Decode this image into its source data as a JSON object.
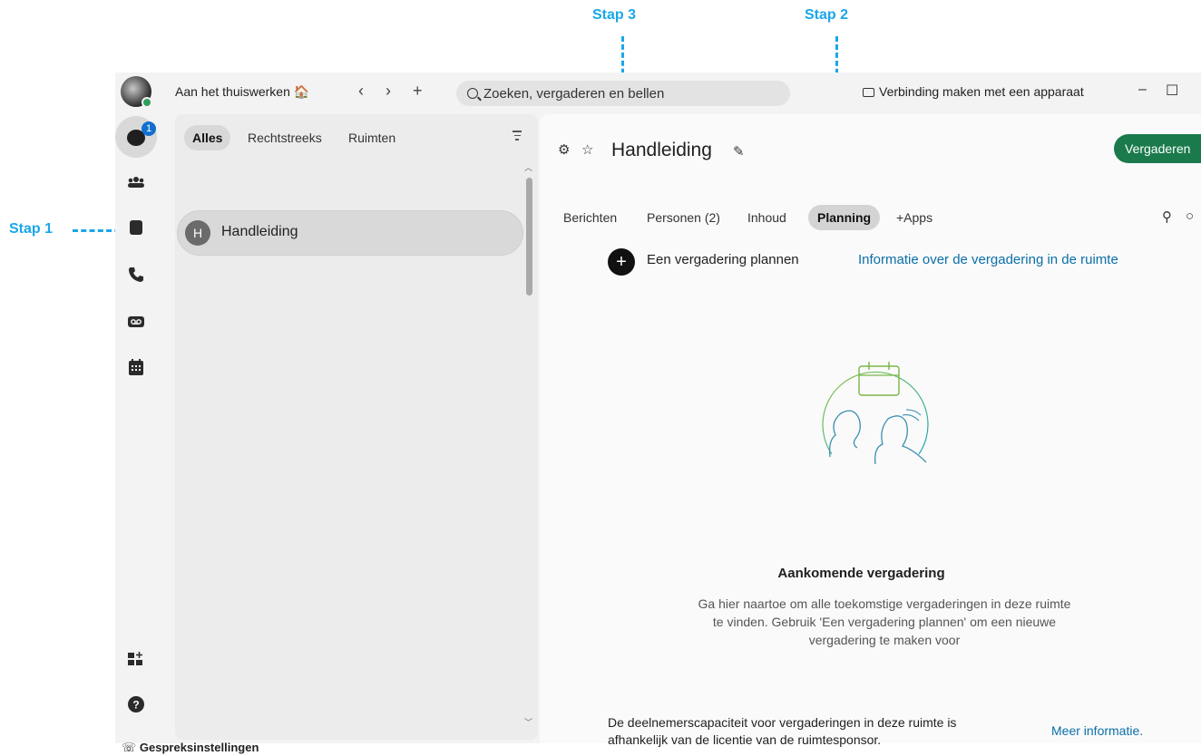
{
  "annotations": {
    "step1": "Stap 1",
    "step2": "Stap 2",
    "step3": "Stap 3",
    "color": "#1aa7e8"
  },
  "titlebar": {
    "status": "Aan het thuiswerken 🏠",
    "back_icon": "chevron-left-icon",
    "forward_icon": "chevron-right-icon",
    "add_icon": "plus-icon",
    "search_placeholder": "Zoeken, vergaderen en bellen",
    "connect_device": "Verbinding maken met een apparaat",
    "minimize": "–",
    "maximize": "☐"
  },
  "left_rail": {
    "badge_count": "1",
    "items": [
      "messaging-icon",
      "teams-icon",
      "contacts-icon",
      "phone-icon",
      "voicemail-icon",
      "calendar-icon"
    ],
    "bottom_items": [
      "apps-icon",
      "help-icon"
    ]
  },
  "list": {
    "filters": [
      "Alles",
      "Rechtstreeks",
      "Ruimten"
    ],
    "spaces": [
      {
        "initial": "H",
        "name": "Handleiding"
      }
    ]
  },
  "space": {
    "title": "Handleiding",
    "meet_button": "Vergaderen",
    "tabs": [
      "Berichten",
      "Personen (2)",
      "Inhoud",
      "Planning",
      "+Apps"
    ],
    "active_tab": "Planning",
    "schedule_button": "Een vergadering plannen",
    "info_link": "Informatie over de vergadering in de ruimte",
    "empty_title": "Aankomende vergadering",
    "empty_desc": "Ga hier naartoe om alle toekomstige vergaderingen in deze ruimte te vinden. Gebruik 'Een vergadering plannen' om een nieuwe vergadering te maken voor",
    "footer_text": "De deelnemerscapaciteit voor vergaderingen in deze ruimte is afhankelijk van de licentie van de ruimtesponsor.",
    "footer_link": "Meer informatie.",
    "accent": "#1a7a4c",
    "link_color": "#0b6fa8"
  },
  "bottom": {
    "call_settings": "Gespreksinstellingen"
  }
}
